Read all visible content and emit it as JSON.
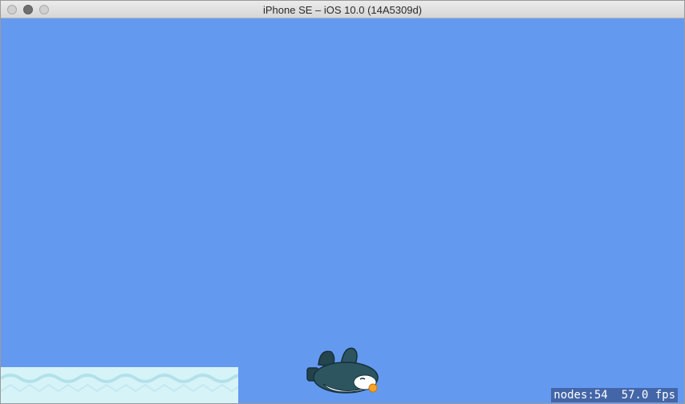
{
  "window": {
    "title": "iPhone SE – iOS 10.0 (14A5309d)"
  },
  "scene": {
    "sky_color": "#6499f0",
    "ground_color": "#d6f3f8",
    "wave_color": "#b3e1ea",
    "penguin_body_color": "#2c5560",
    "penguin_beak_color": "#f6a428"
  },
  "debug": {
    "nodes_label": "nodes:54",
    "fps_label": "57.0 fps"
  }
}
